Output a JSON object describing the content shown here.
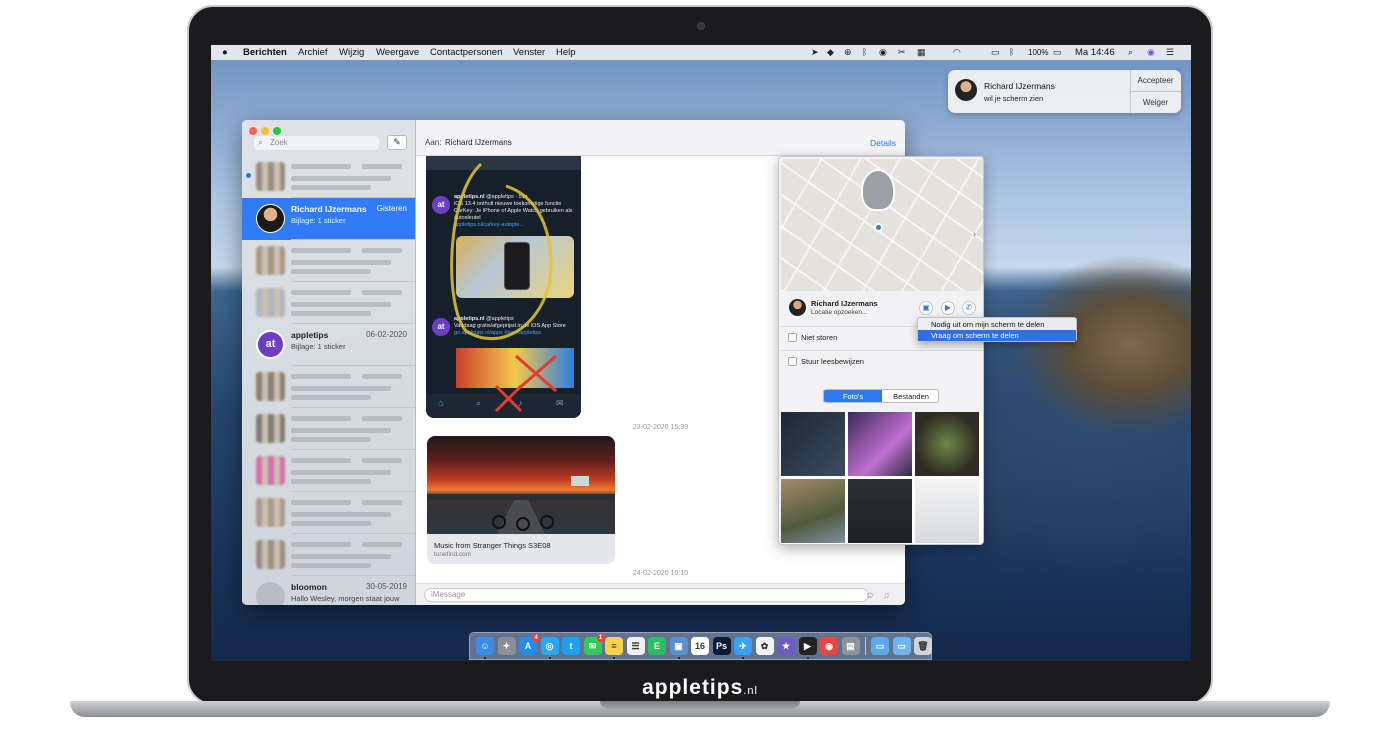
{
  "brand": {
    "name": "appletips",
    "suffix": ".nl"
  },
  "menubar": {
    "app_name": "Berichten",
    "menus": [
      "Archief",
      "Wijzig",
      "Weergave",
      "Contactpersonen",
      "Venster",
      "Help"
    ],
    "battery": "100%",
    "clock": "Ma 14:46",
    "icons": [
      "location-icon",
      "dropbox-icon",
      "timemachine-icon",
      "bluetooth-alt-icon",
      "eye-icon",
      "scissors-icon",
      "grid-icon",
      "wifi-icon",
      "airplay-icon",
      "bluetooth-icon",
      "battery-icon",
      "search-icon",
      "siri-icon",
      "list-icon"
    ]
  },
  "notification": {
    "sender": "Richard IJzermans",
    "body": "wil je scherm zien",
    "accept_label": "Accepteer",
    "decline_label": "Weiger"
  },
  "sidebar": {
    "search_placeholder": "Zoek",
    "conversations": [
      {
        "name": "",
        "date": "",
        "preview": "",
        "blurred": true,
        "unread": true,
        "color": "#8a7a6a"
      },
      {
        "name": "Richard IJzermans",
        "date": "Gisteren",
        "preview": "Bijlage: 1 sticker",
        "blurred": false,
        "selected": true,
        "color": "#222222"
      },
      {
        "name": "",
        "date": "",
        "preview": "",
        "blurred": true,
        "color": "#9b8670"
      },
      {
        "name": "",
        "date": "",
        "preview": "",
        "blurred": true,
        "color": "#a9adb6"
      },
      {
        "name": "appletips",
        "date": "06-02-2020",
        "preview": "Bijlage: 1 sticker",
        "blurred": false,
        "color": "#6c3fc2",
        "initials": "at"
      },
      {
        "name": "",
        "date": "",
        "preview": "",
        "blurred": true,
        "color": "#7d6b55"
      },
      {
        "name": "",
        "date": "",
        "preview": "",
        "blurred": true,
        "color": "#6e675e"
      },
      {
        "name": "",
        "date": "",
        "preview": "",
        "blurred": true,
        "color": "#d9549d"
      },
      {
        "name": "",
        "date": "",
        "preview": "",
        "blurred": true,
        "color": "#a68c78"
      },
      {
        "name": "",
        "date": "",
        "preview": "",
        "blurred": true,
        "color": "#8f7c6b"
      },
      {
        "name": "bloomon",
        "date": "30-05-2019",
        "preview": "Hallo Wesley, morgen staat jouw bezorging gepland tusse...",
        "blurred": false,
        "color": "#b8bcc4"
      }
    ]
  },
  "chat": {
    "to_label": "Aan:",
    "recipient": "Richard IJzermans",
    "details_label": "Details",
    "tweets": [
      {
        "account": "appletips.nl",
        "handle": "@appletips · 51s",
        "text": "iOS 13.4 onthult nieuwe toekomstige functie CarKey: Je iPhone of Apple Watch gebruiken als autosleutel",
        "link": "appletips.nl/carkey-autople..."
      },
      {
        "account": "appletips.nl",
        "handle": "@appletips",
        "text": "Vandaag gratis/afgeprijsd in de iOS App Store",
        "link": "go.appletips.nl/apps #ios #appletips"
      }
    ],
    "timestamp_1": "23-02-2020 15:39",
    "link_card": {
      "title": "Music from Stranger Things S3E08",
      "domain": "tunefind.com"
    },
    "timestamp_2": "24-02-2020 10:10",
    "input_placeholder": "iMessage"
  },
  "details": {
    "contact_name": "Richard IJzermans",
    "contact_status": "Locatie opzoeken...",
    "do_not_disturb_label": "Niet storen",
    "read_receipts_label": "Stuur leesbewijzen",
    "segments": [
      "Foto's",
      "Bestanden"
    ],
    "active_segment": "Foto's"
  },
  "context_menu": {
    "items": [
      "Nodig uit om mijn scherm te delen",
      "Vraag om scherm te delen"
    ],
    "selected": "Vraag om scherm te delen"
  },
  "dock": {
    "apps": [
      {
        "name": "finder-icon",
        "color": "#3b8be8",
        "glyph": "☺"
      },
      {
        "name": "launchpad-icon",
        "color": "#8a8f99",
        "glyph": "✦"
      },
      {
        "name": "app-store-icon",
        "color": "#1f8ef0",
        "glyph": "A",
        "badge": "4"
      },
      {
        "name": "safari-icon",
        "color": "#2aa7f0",
        "glyph": "◎"
      },
      {
        "name": "twitter-icon",
        "color": "#1da1f2",
        "glyph": "t"
      },
      {
        "name": "messages-icon",
        "color": "#34c759",
        "glyph": "✉",
        "badge": "1"
      },
      {
        "name": "notes-icon",
        "color": "#f6d24a",
        "glyph": "≡"
      },
      {
        "name": "reminders-icon",
        "color": "#f2f2f2",
        "glyph": "☰"
      },
      {
        "name": "evernote-icon",
        "color": "#2dbe60",
        "glyph": "E"
      },
      {
        "name": "preview-icon",
        "color": "#5a8fd1",
        "glyph": "▣"
      },
      {
        "name": "calendar-icon",
        "color": "#ffffff",
        "glyph": "16"
      },
      {
        "name": "photoshop-icon",
        "color": "#0c1a33",
        "glyph": "Ps"
      },
      {
        "name": "tweetbot-icon",
        "color": "#3aa0f4",
        "glyph": "✈"
      },
      {
        "name": "photos-icon",
        "color": "#f4f4f4",
        "glyph": "✿"
      },
      {
        "name": "imovie-icon",
        "color": "#6d5cc2",
        "glyph": "★"
      },
      {
        "name": "final-cut-icon",
        "color": "#222222",
        "glyph": "▶"
      },
      {
        "name": "chrome-icon",
        "color": "#e8453c",
        "glyph": "◉"
      },
      {
        "name": "screenshot-icon",
        "color": "#8d949e",
        "glyph": "▤"
      },
      {
        "name": "folder-icon",
        "color": "#5aa9ea",
        "glyph": "▭"
      },
      {
        "name": "downloads-icon",
        "color": "#6fb4ee",
        "glyph": "▭"
      },
      {
        "name": "trash-icon",
        "color": "#d0d4d9",
        "glyph": "🗑"
      }
    ]
  },
  "colors": {
    "accent": "#2a7ae2",
    "selection": "#2e6fe2",
    "window_close": "#ff5f57",
    "window_minimize": "#febc2e",
    "window_zoom": "#28c840"
  }
}
